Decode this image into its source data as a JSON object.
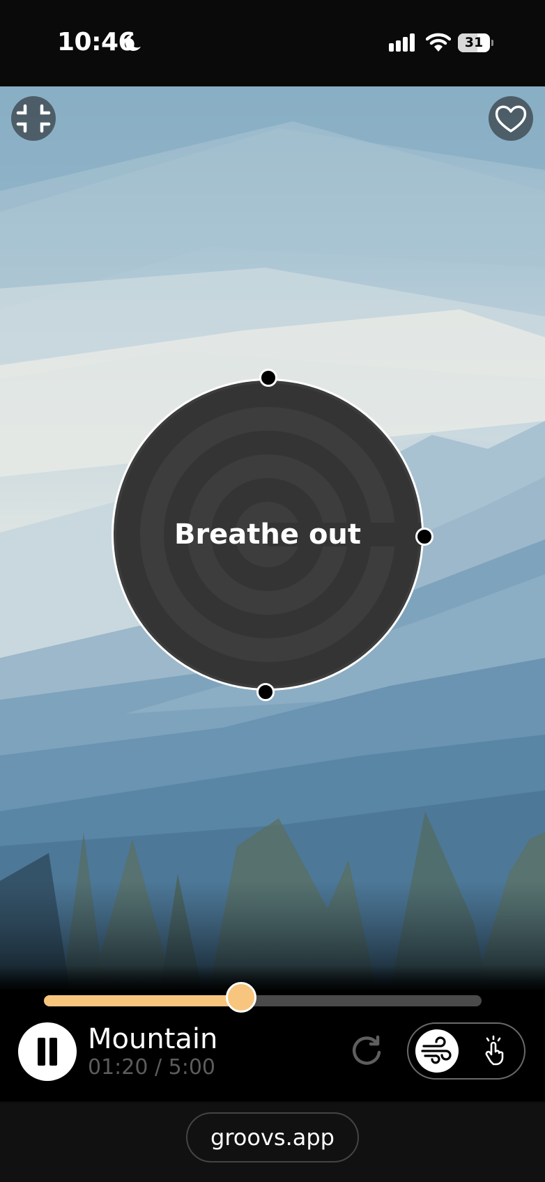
{
  "status_bar": {
    "time": "10:46",
    "battery_level": "31",
    "icons": [
      "moon-icon",
      "signal-icon",
      "wifi-icon",
      "battery-icon"
    ]
  },
  "scene": {
    "name": "Mountain",
    "top_left_icon": "collapse-icon",
    "top_right_icon": "heart-icon"
  },
  "breath": {
    "label": "Breathe out"
  },
  "player": {
    "title": "Mountain",
    "time": "01:20 / 5:00",
    "progress": 0.45,
    "accent_color": "#f8c57e",
    "play_icon": "pause-icon",
    "replay_icon": "replay-icon",
    "modes": [
      {
        "icon": "wind-icon",
        "selected": true
      },
      {
        "icon": "tap-hand-icon",
        "selected": false
      }
    ]
  },
  "footer": {
    "url": "groovs.app"
  }
}
